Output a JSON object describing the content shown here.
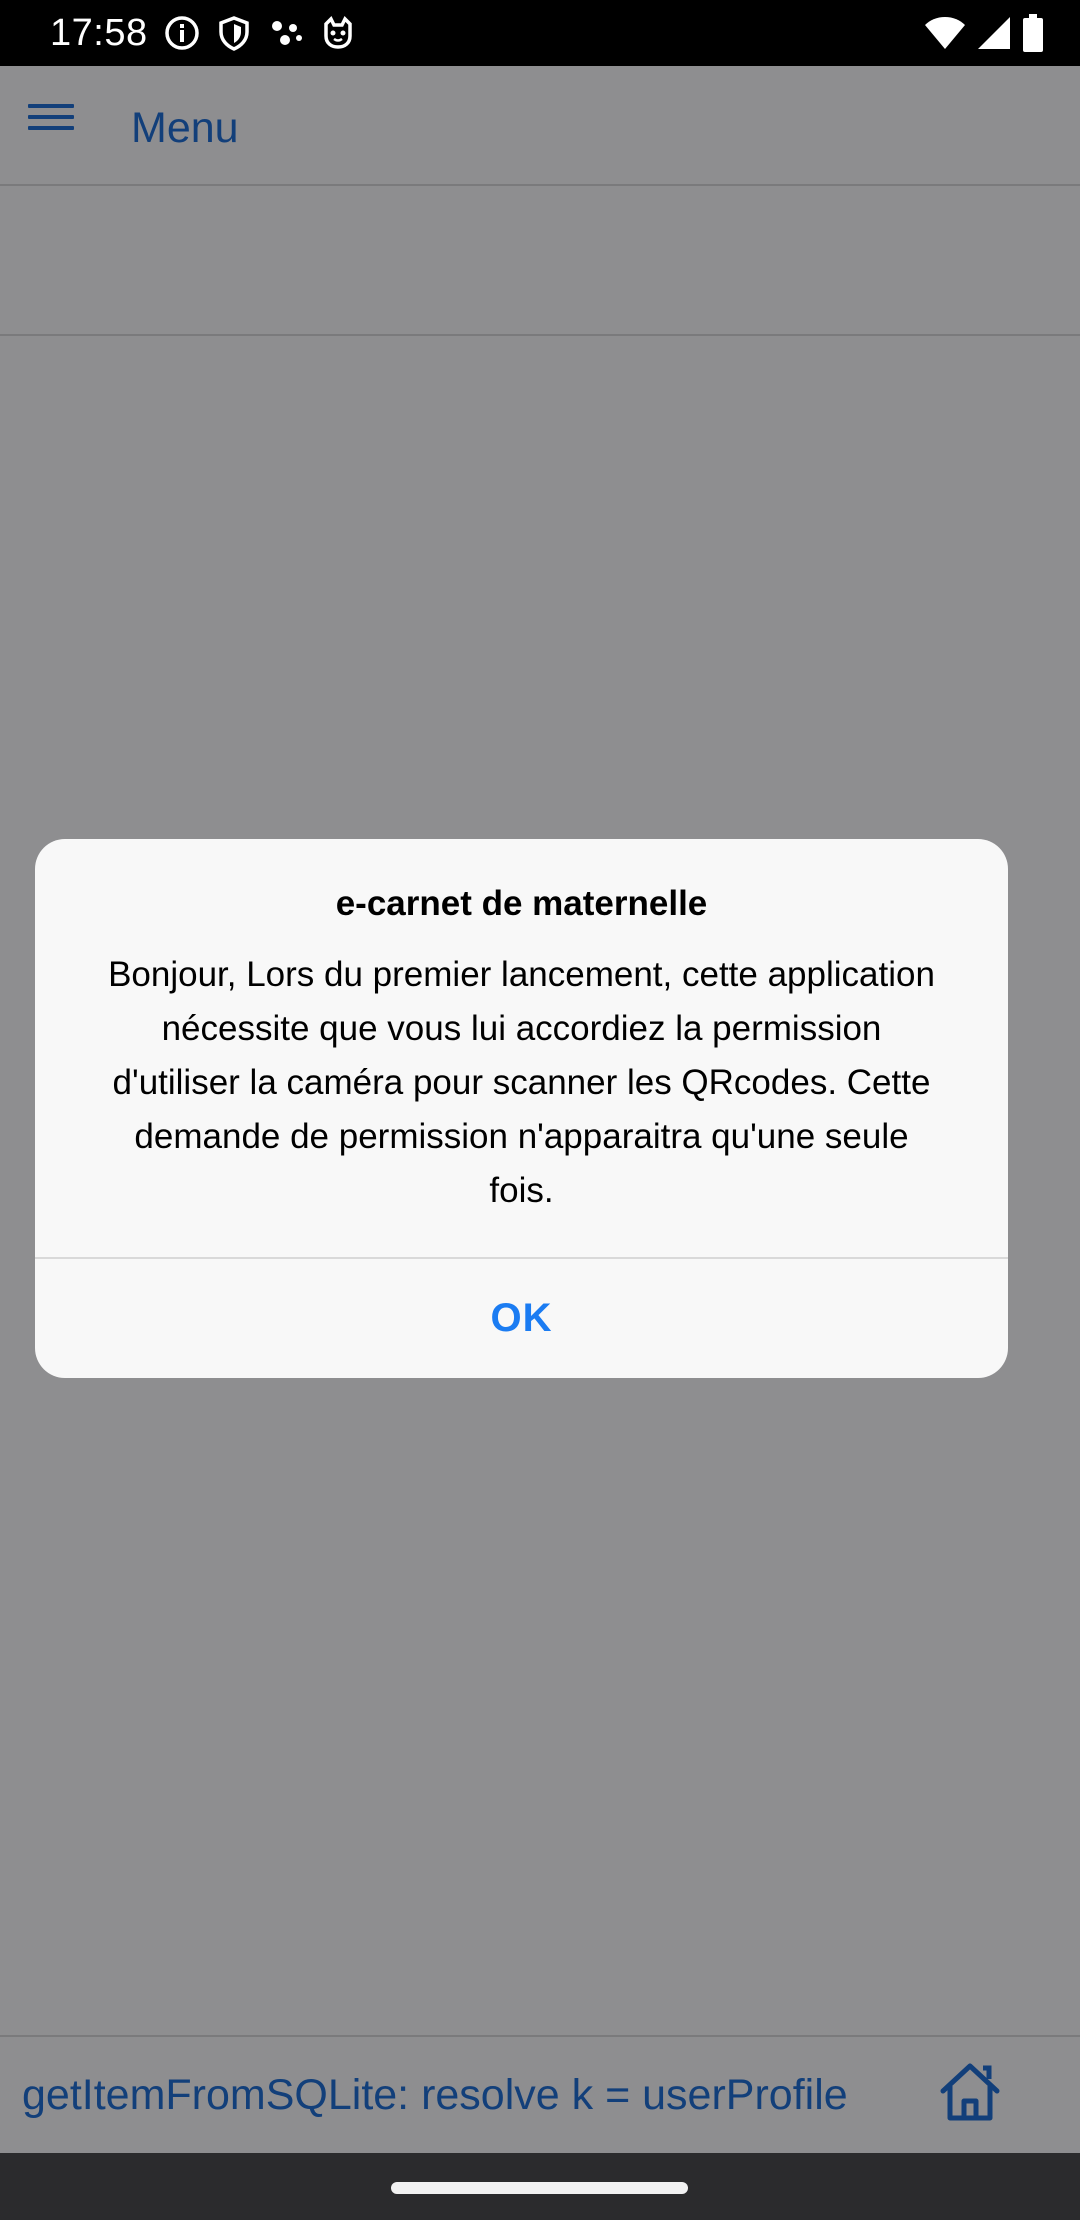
{
  "status_bar": {
    "time": "17:58",
    "icons_left": [
      "info-circle-icon",
      "shield-icon",
      "dots-icon",
      "cat-face-icon"
    ],
    "icons_right": [
      "wifi-icon",
      "signal-icon",
      "battery-icon"
    ]
  },
  "header": {
    "menu_label": "Menu"
  },
  "dialog": {
    "title": "e-carnet de maternelle",
    "message": "Bonjour, Lors du premier lancement, cette application nécessite que vous lui accordiez la permission d'utiliser la caméra pour scanner les QRcodes. Cette demande de permission n'apparaitra qu'une seule fois.",
    "ok_label": "OK"
  },
  "bottom_bar": {
    "debug_text": "getItemFromSQLite: resolve k = userProfile"
  },
  "colors": {
    "overlay_bg": "#8e8e90",
    "link_blue": "#123f7a",
    "dialog_button": "#1b7cf2",
    "dialog_bg": "#f8f8f8"
  }
}
